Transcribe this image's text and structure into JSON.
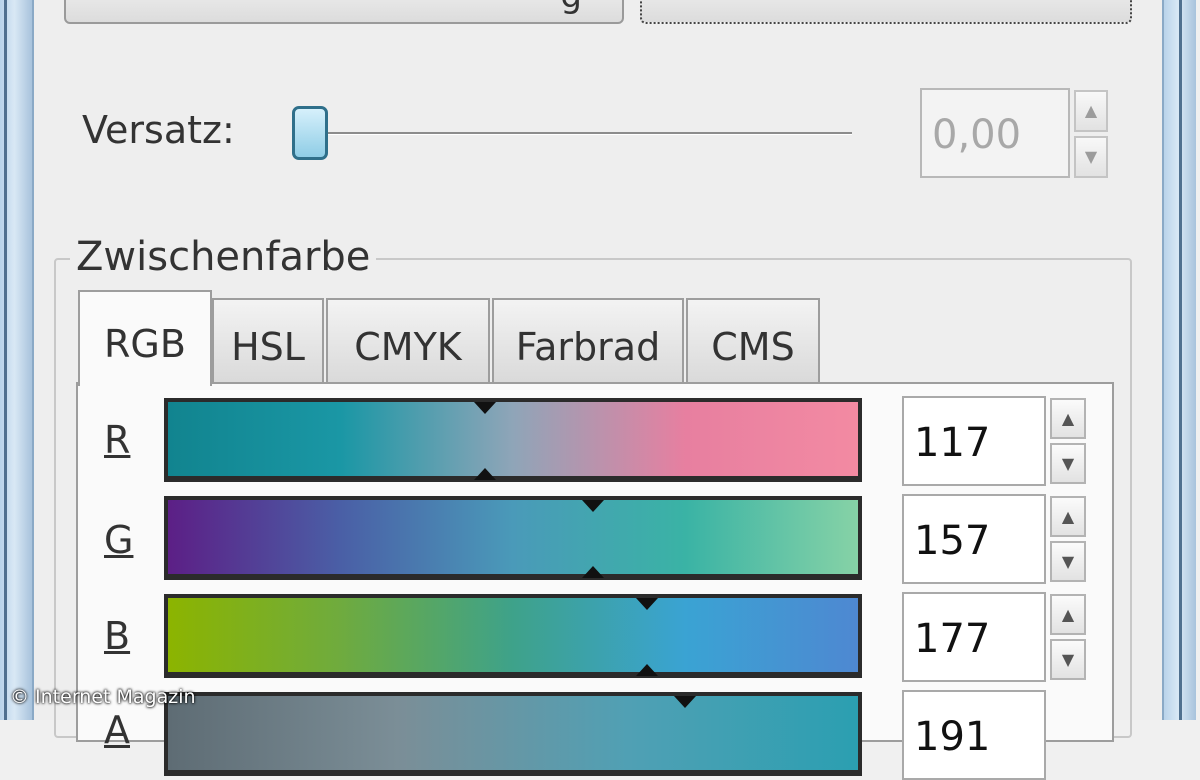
{
  "offset": {
    "label": "Versatz:",
    "value": "0,00",
    "slider_fraction": 0.0
  },
  "group": {
    "title": "Zwischenfarbe"
  },
  "tabs": [
    {
      "label": "RGB",
      "active": true
    },
    {
      "label": "HSL",
      "active": false
    },
    {
      "label": "CMYK",
      "active": false
    },
    {
      "label": "Farbrad",
      "active": false
    },
    {
      "label": "CMS",
      "active": false
    }
  ],
  "channels": [
    {
      "label": "R",
      "value": "117",
      "max": 255,
      "gradient": [
        "#11848f",
        "#1a97a5",
        "#8fa5b8",
        "#e77fa0",
        "#f38aa2"
      ]
    },
    {
      "label": "G",
      "value": "157",
      "max": 255,
      "gradient": [
        "#5c1f86",
        "#4a5fa6",
        "#4a9ab9",
        "#3ab3a5",
        "#86d2a6"
      ]
    },
    {
      "label": "B",
      "value": "177",
      "max": 255,
      "gradient": [
        "#8cb400",
        "#6fab3e",
        "#3ea28a",
        "#3aa3d3",
        "#4e88d2"
      ]
    },
    {
      "label": "A",
      "value": "191",
      "max": 255,
      "gradient": [
        "#5e6c74",
        "#7b8e97",
        "#50a0b4",
        "#2b9fb1"
      ]
    }
  ],
  "spinner": {
    "up_icon": "▲",
    "down_icon": "▼"
  },
  "watermark": "© Internet Magazin"
}
